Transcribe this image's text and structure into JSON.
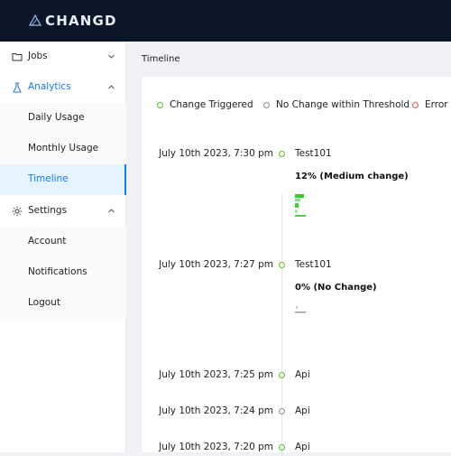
{
  "app": {
    "brand": "CHANGD"
  },
  "colors": {
    "topbar": "#0a1628",
    "accent": "#1677ff",
    "green": "#52c41a",
    "grey": "#8c8c8c",
    "red": "#ff4d4f"
  },
  "sidebar": {
    "jobs": {
      "label": "Jobs",
      "icon": "folder-icon"
    },
    "analytics": {
      "label": "Analytics",
      "icon": "flask-icon",
      "items": [
        {
          "label": "Daily Usage"
        },
        {
          "label": "Monthly Usage"
        },
        {
          "label": "Timeline"
        }
      ]
    },
    "settings": {
      "label": "Settings",
      "icon": "gear-icon",
      "items": [
        {
          "label": "Account"
        },
        {
          "label": "Notifications"
        },
        {
          "label": "Logout"
        }
      ]
    }
  },
  "page": {
    "title": "Timeline"
  },
  "legend": [
    {
      "label": "Change Triggered",
      "color": "#52c41a"
    },
    {
      "label": "No Change within Threshold",
      "color": "#8c8c8c"
    },
    {
      "label": "Error",
      "color": "#ff4d4f"
    }
  ],
  "timeline": [
    {
      "time": "July 10th 2023, 7:30 pm",
      "name": "Test101",
      "change": "12% (Medium change)",
      "status": "green"
    },
    {
      "time": "July 10th 2023, 7:27 pm",
      "name": "Test101",
      "change": "0% (No Change)",
      "status": "green"
    },
    {
      "time": "July 10th 2023, 7:25 pm",
      "name": "Api",
      "change": "",
      "status": "green"
    },
    {
      "time": "July 10th 2023, 7:24 pm",
      "name": "Api",
      "change": "",
      "status": "grey"
    },
    {
      "time": "July 10th 2023, 7:20 pm",
      "name": "Api",
      "change": "",
      "status": "green"
    }
  ]
}
